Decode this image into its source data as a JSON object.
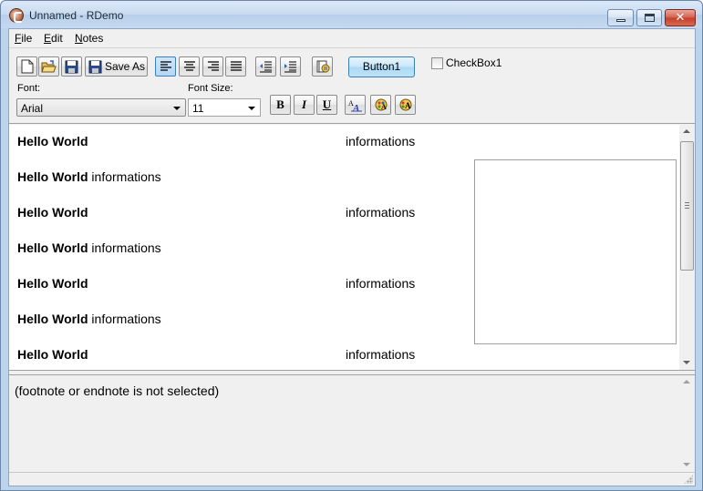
{
  "window": {
    "title": "Unnamed - RDemo"
  },
  "menu": [
    {
      "underline": "F",
      "rest": "ile"
    },
    {
      "underline": "E",
      "rest": "dit"
    },
    {
      "underline": "N",
      "rest": "otes"
    }
  ],
  "toolbar": {
    "save_as_label": "Save As",
    "button1_label": "Button1",
    "checkbox_label": "CheckBox1",
    "checkbox_checked": false,
    "font_label": "Font:",
    "font_value": "Arial",
    "size_label": "Font Size:",
    "size_value": "11",
    "bold_label": "B",
    "italic_label": "I",
    "underline_label": "U",
    "active_alignment": "left"
  },
  "editor": {
    "rows": [
      {
        "bold": "Hello World",
        "inline": "",
        "right": "informations"
      },
      {
        "bold": "Hello World",
        "inline": " informations",
        "right": ""
      },
      {
        "bold": "Hello World",
        "inline": "",
        "right": "informations"
      },
      {
        "bold": "Hello World",
        "inline": " informations",
        "right": ""
      },
      {
        "bold": "Hello World",
        "inline": "",
        "right": "informations"
      },
      {
        "bold": "Hello World",
        "inline": " informations",
        "right": ""
      },
      {
        "bold": "Hello World",
        "inline": "",
        "right": "informations"
      }
    ]
  },
  "notes": {
    "text": "(footnote or endnote is not selected)"
  }
}
